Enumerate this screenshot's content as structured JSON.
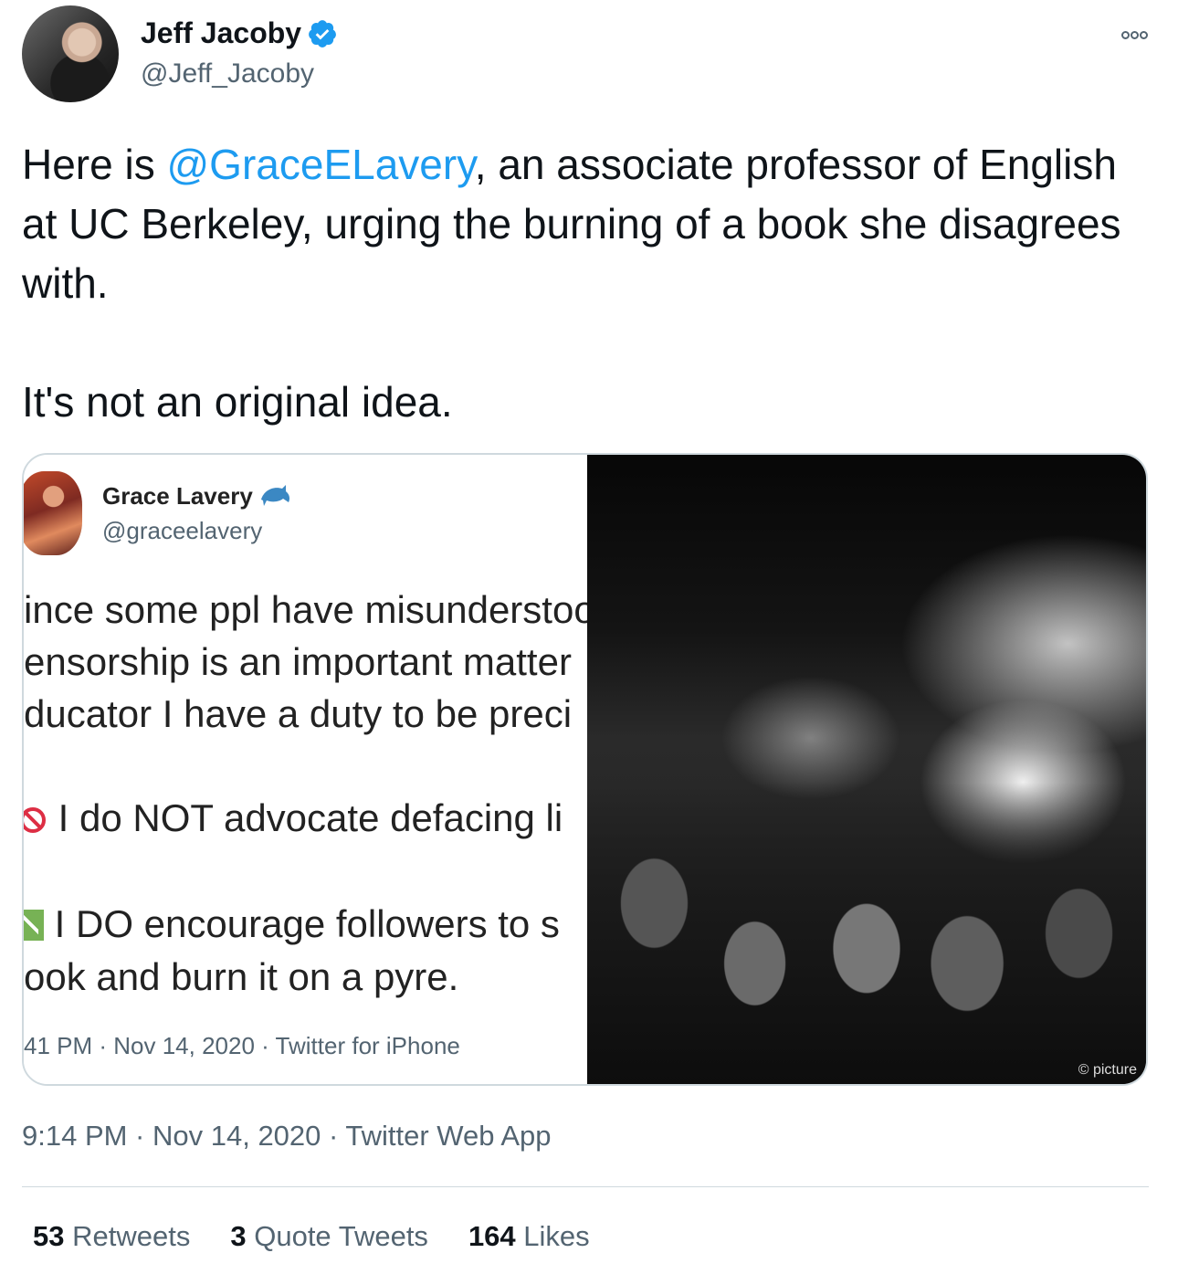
{
  "author": {
    "name": "Jeff Jacoby",
    "handle": "@Jeff_Jacoby",
    "verified": true
  },
  "tweet": {
    "text_before": "Here is ",
    "mention": "@GraceELavery",
    "text_after": ", an associate professor of English at UC Berkeley, urging the burning of a book she disagrees with.",
    "text_second": "It's not an original idea."
  },
  "embedded_screenshot": {
    "name": "Grace Lavery",
    "handle": "@graceelavery",
    "lines": [
      "ince some ppl have misunderstoo",
      "ensorship is an important matter",
      "ducator I have a duty to be preci"
    ],
    "line_no": "I do NOT advocate defacing li",
    "line_yes": "I DO encourage followers to s",
    "line_last": "ook and burn it on a pyre.",
    "meta": "41 PM · Nov 14, 2020 · Twitter for iPhone"
  },
  "photo": {
    "credit": "© picture"
  },
  "timestamp": "9:14 PM · Nov 14, 2020 · Twitter Web App",
  "stats": {
    "retweets": "53",
    "retweets_label": "Retweets",
    "quotes": "3",
    "quotes_label": "Quote Tweets",
    "likes": "164",
    "likes_label": "Likes"
  },
  "colors": {
    "link": "#1d9bf0",
    "secondary": "#536471",
    "text": "#0f1419",
    "border": "#cfd9de"
  },
  "icons": [
    "verified-badge-icon",
    "more-options-icon",
    "dolphin-icon",
    "no-entry-icon",
    "check-mark-icon"
  ]
}
